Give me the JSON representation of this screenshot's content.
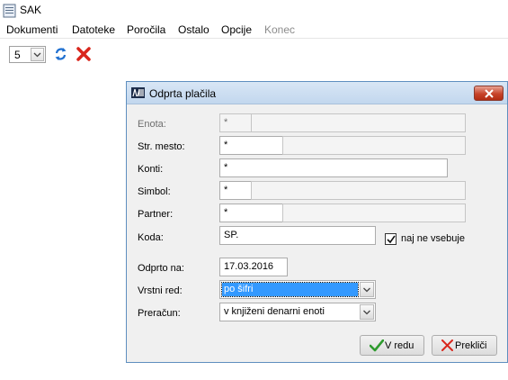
{
  "window": {
    "title": "SAK"
  },
  "menu": {
    "items": [
      "Dokumenti",
      "Datoteke",
      "Poročila",
      "Ostalo",
      "Opcije",
      "Konec"
    ]
  },
  "toolbar": {
    "page_size_value": "5"
  },
  "dialog": {
    "title": "Odprta plačila",
    "fields": {
      "enota": {
        "label": "Enota:",
        "value": "*",
        "value2": ""
      },
      "str_mesto": {
        "label": "Str. mesto:",
        "value": "*",
        "value2": ""
      },
      "konti": {
        "label": "Konti:",
        "value": "*"
      },
      "simbol": {
        "label": "Simbol:",
        "value": "*",
        "value2": ""
      },
      "partner": {
        "label": "Partner:",
        "value": "*",
        "value2": ""
      },
      "koda": {
        "label": "Koda:",
        "value": "SP."
      },
      "odprto_na": {
        "label": "Odprto na:",
        "value": "17.03.2016"
      },
      "vrstni_red": {
        "label": "Vrstni red:",
        "value": "po šifri"
      },
      "preracun": {
        "label": "Preračun:",
        "value": "v knjiženi denarni enoti"
      }
    },
    "checkbox": {
      "label": "naj ne vsebuje",
      "checked": true
    },
    "buttons": {
      "ok": "V redu",
      "cancel": "Prekliči"
    }
  },
  "colors": {
    "selection": "#3399ff",
    "close_button": "#c7432a",
    "ok_check": "#2e9b2e",
    "cancel_x": "#d9261c",
    "refresh": "#1e6fd0"
  }
}
